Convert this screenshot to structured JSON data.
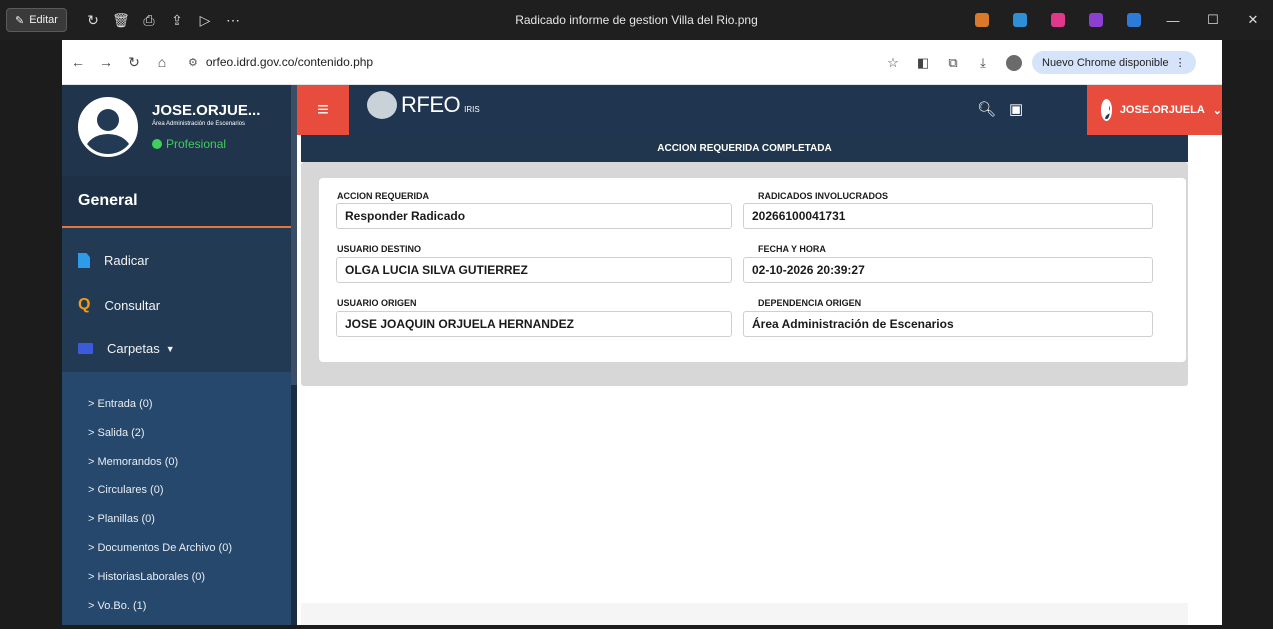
{
  "viewer": {
    "edit_label": "Editar",
    "title": "Radicado informe de gestion Villa del Rio.png"
  },
  "browser": {
    "url": "orfeo.idrd.gov.co/contenido.php",
    "update_label": "Nuevo Chrome disponible"
  },
  "sidebar": {
    "user_name": "JOSE.ORJUE...",
    "area": "Área Administración de Escenarios",
    "role": "Profesional",
    "section": "General",
    "menu": [
      {
        "label": "Radicar"
      },
      {
        "label": "Consultar"
      },
      {
        "label": "Carpetas"
      }
    ],
    "folders": [
      "> Entrada (0)",
      "> Salida (2)",
      "> Memorandos (0)",
      "> Circulares (0)",
      "> Planillas (0)",
      "> Documentos De Archivo (0)",
      "> HistoriasLaborales (0)",
      "> Vo.Bo. (1)"
    ]
  },
  "header": {
    "logo_text": "RFEO",
    "logo_sub": "IRIS",
    "user_label": "JOSE.ORJUELA"
  },
  "main": {
    "banner": "ACCION REQUERIDA COMPLETADA",
    "fields": {
      "accion_label": "ACCION REQUERIDA",
      "accion_value": "Responder Radicado",
      "radicados_label": "RADICADOS INVOLUCRADOS",
      "radicados_value": "20266100041731",
      "usuario_destino_label": "USUARIO DESTINO",
      "usuario_destino_value": "OLGA LUCIA SILVA GUTIERREZ",
      "fecha_label": "FECHA Y HORA",
      "fecha_value": "02-10-2026 20:39:27",
      "usuario_origen_label": "USUARIO ORIGEN",
      "usuario_origen_value": "JOSE JOAQUIN ORJUELA HERNANDEZ",
      "dependencia_label": "DEPENDENCIA ORIGEN",
      "dependencia_value": "Área Administración de Escenarios"
    }
  }
}
